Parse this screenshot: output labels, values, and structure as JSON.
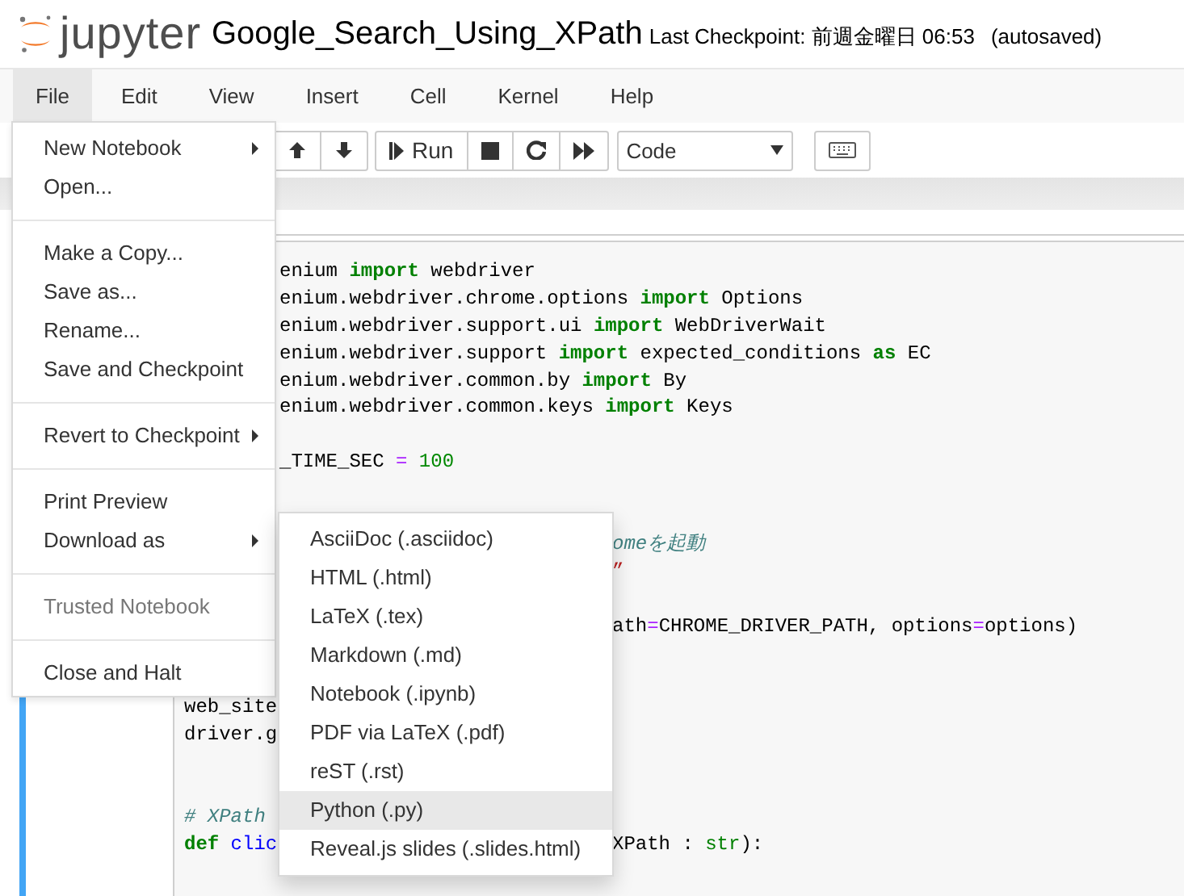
{
  "header": {
    "logo_text": "jupyter",
    "notebook_name": "Google_Search_Using_XPath",
    "checkpoint": "Last Checkpoint: 前週金曜日 06:53",
    "autosave": "(autosaved)"
  },
  "menubar": [
    {
      "label": "File",
      "selected": true
    },
    {
      "label": "Edit",
      "selected": false
    },
    {
      "label": "View",
      "selected": false
    },
    {
      "label": "Insert",
      "selected": false
    },
    {
      "label": "Cell",
      "selected": false
    },
    {
      "label": "Kernel",
      "selected": false
    },
    {
      "label": "Help",
      "selected": false
    }
  ],
  "toolbar": {
    "buttons": [
      {
        "kind": "up"
      },
      {
        "kind": "down"
      },
      {
        "kind": "run",
        "label": "Run"
      },
      {
        "kind": "stop"
      },
      {
        "kind": "restart"
      },
      {
        "kind": "forward"
      }
    ],
    "cell_type": "Code"
  },
  "file_menu": [
    {
      "kind": "item",
      "label": "New Notebook",
      "disabled": false,
      "submenu": true
    },
    {
      "kind": "item",
      "label": "Open...",
      "disabled": false,
      "submenu": false
    },
    {
      "kind": "divider"
    },
    {
      "kind": "item",
      "label": "Make a Copy...",
      "disabled": false,
      "submenu": false
    },
    {
      "kind": "item",
      "label": "Save as...",
      "disabled": false,
      "submenu": false
    },
    {
      "kind": "item",
      "label": "Rename...",
      "disabled": false,
      "submenu": false
    },
    {
      "kind": "item",
      "label": "Save and Checkpoint",
      "disabled": false,
      "submenu": false
    },
    {
      "kind": "divider"
    },
    {
      "kind": "item",
      "label": "Revert to Checkpoint",
      "disabled": false,
      "submenu": true
    },
    {
      "kind": "divider"
    },
    {
      "kind": "item",
      "label": "Print Preview",
      "disabled": false,
      "submenu": false
    },
    {
      "kind": "item",
      "label": "Download as",
      "disabled": false,
      "submenu": true,
      "expanded": true,
      "children": [
        {
          "label": "AsciiDoc (.asciidoc)",
          "selected": false
        },
        {
          "label": "HTML (.html)",
          "selected": false
        },
        {
          "label": "LaTeX (.tex)",
          "selected": false
        },
        {
          "label": "Markdown (.md)",
          "selected": false
        },
        {
          "label": "Notebook (.ipynb)",
          "selected": false
        },
        {
          "label": "PDF via LaTeX (.pdf)",
          "selected": false
        },
        {
          "label": "reST (.rst)",
          "selected": false
        },
        {
          "label": "Python (.py)",
          "selected": true
        },
        {
          "label": "Reveal.js slides (.slides.html)",
          "selected": false
        }
      ]
    },
    {
      "kind": "divider"
    },
    {
      "kind": "item",
      "label": "Trusted Notebook",
      "disabled": true,
      "submenu": false
    },
    {
      "kind": "divider"
    },
    {
      "kind": "item",
      "label": "Close and Halt",
      "disabled": false,
      "submenu": false
    }
  ],
  "code_cell": {
    "selected": true,
    "lines": [
      {
        "kind": "code",
        "parts": [
          {
            "kind": "menu_edge",
            "tokens": [
              {
                "kind": "plain",
                "text": "enium "
              },
              {
                "kind": "keyword",
                "text": "import"
              },
              {
                "kind": "plain",
                "text": " webdriver"
              }
            ]
          }
        ]
      },
      {
        "kind": "code",
        "parts": [
          {
            "kind": "menu_edge",
            "tokens": [
              {
                "kind": "plain",
                "text": "enium.webdriver.chrome.options "
              },
              {
                "kind": "keyword",
                "text": "import"
              },
              {
                "kind": "plain",
                "text": " Options"
              }
            ]
          }
        ]
      },
      {
        "kind": "code",
        "parts": [
          {
            "kind": "menu_edge",
            "tokens": [
              {
                "kind": "plain",
                "text": "enium.webdriver.support.ui "
              },
              {
                "kind": "keyword",
                "text": "import"
              },
              {
                "kind": "plain",
                "text": " WebDriverWait"
              }
            ]
          }
        ]
      },
      {
        "kind": "code",
        "parts": [
          {
            "kind": "menu_edge",
            "tokens": [
              {
                "kind": "plain",
                "text": "enium.webdriver.support "
              },
              {
                "kind": "keyword",
                "text": "import"
              },
              {
                "kind": "plain",
                "text": " expected_conditions "
              },
              {
                "kind": "keyword",
                "text": "as"
              },
              {
                "kind": "plain",
                "text": " EC"
              }
            ]
          }
        ]
      },
      {
        "kind": "code",
        "parts": [
          {
            "kind": "menu_edge",
            "tokens": [
              {
                "kind": "plain",
                "text": "enium.webdriver.common.by "
              },
              {
                "kind": "keyword",
                "text": "import"
              },
              {
                "kind": "plain",
                "text": " By"
              }
            ]
          }
        ]
      },
      {
        "kind": "code",
        "parts": [
          {
            "kind": "menu_edge",
            "tokens": [
              {
                "kind": "plain",
                "text": "enium.webdriver.common.keys "
              },
              {
                "kind": "keyword",
                "text": "import"
              },
              {
                "kind": "plain",
                "text": " Keys"
              }
            ]
          }
        ]
      },
      {
        "kind": "blank"
      },
      {
        "kind": "code",
        "parts": [
          {
            "kind": "menu_edge",
            "tokens": [
              {
                "kind": "plain",
                "text": "_TIME_SEC "
              },
              {
                "kind": "operator",
                "text": "="
              },
              {
                "kind": "number",
                "text": " 100"
              }
            ]
          }
        ]
      },
      {
        "kind": "blank"
      },
      {
        "kind": "blank"
      },
      {
        "kind": "code",
        "parts": [
          {
            "kind": "submenu_edge",
            "tokens": [
              {
                "kind": "comment",
                "text": "omeを起動"
              }
            ]
          }
        ]
      },
      {
        "kind": "code",
        "parts": [
          {
            "kind": "submenu_edge",
            "tokens": [
              {
                "kind": "string",
                "text": "”"
              }
            ]
          }
        ]
      },
      {
        "kind": "blank"
      },
      {
        "kind": "code",
        "parts": [
          {
            "kind": "submenu_edge",
            "tokens": [
              {
                "kind": "plain",
                "text": "ath"
              },
              {
                "kind": "operator",
                "text": "="
              },
              {
                "kind": "plain",
                "text": "CHROME_DRIVER_PATH, options"
              },
              {
                "kind": "operator",
                "text": "="
              },
              {
                "kind": "plain",
                "text": "options)"
              }
            ]
          }
        ]
      },
      {
        "kind": "blank"
      },
      {
        "kind": "blank"
      },
      {
        "kind": "code",
        "parts": [
          {
            "kind": "start",
            "tokens": [
              {
                "kind": "plain",
                "text": "web_site"
              }
            ]
          }
        ]
      },
      {
        "kind": "code",
        "parts": [
          {
            "kind": "start",
            "tokens": [
              {
                "kind": "plain",
                "text": "driver.g"
              }
            ]
          }
        ]
      },
      {
        "kind": "blank"
      },
      {
        "kind": "blank"
      },
      {
        "kind": "code",
        "parts": [
          {
            "kind": "start",
            "tokens": [
              {
                "kind": "comment",
                "text": "# XPath"
              }
            ]
          }
        ]
      },
      {
        "kind": "code",
        "parts": [
          {
            "kind": "start",
            "tokens": [
              {
                "kind": "keyword",
                "text": "def"
              },
              {
                "kind": "defname",
                "text": " clic"
              }
            ]
          },
          {
            "kind": "submenu_edge",
            "tokens": [
              {
                "kind": "plain",
                "text": "XPath : "
              },
              {
                "kind": "builtin",
                "text": "str"
              },
              {
                "kind": "plain",
                "text": "):"
              }
            ]
          }
        ]
      }
    ]
  }
}
